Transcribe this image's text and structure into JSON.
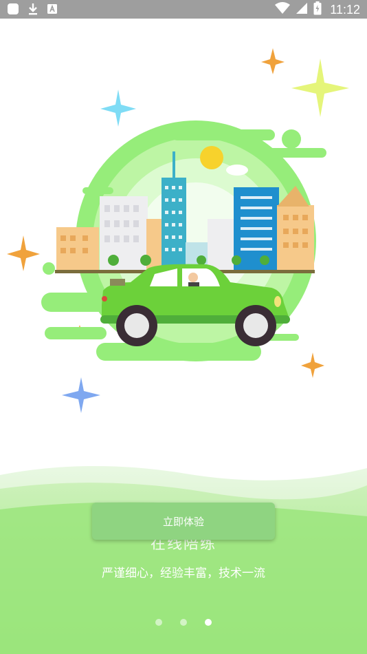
{
  "status_bar": {
    "time": "11:12",
    "left_icons": [
      "app-notification-icon",
      "download-icon",
      "keyboard-a-icon"
    ],
    "right_icons": [
      "wifi-icon",
      "cellular-signal-icon",
      "battery-icon"
    ]
  },
  "onboarding": {
    "faded_title": "在线陪练",
    "tagline": "严谨细心，经验丰富，技术一流",
    "start_button_label": "立即体验",
    "page_count": 3,
    "active_page": 3
  },
  "colors": {
    "accent_green": "#8fd481",
    "status_bar": "#9e9e9e",
    "car_green": "#6cd13a"
  }
}
